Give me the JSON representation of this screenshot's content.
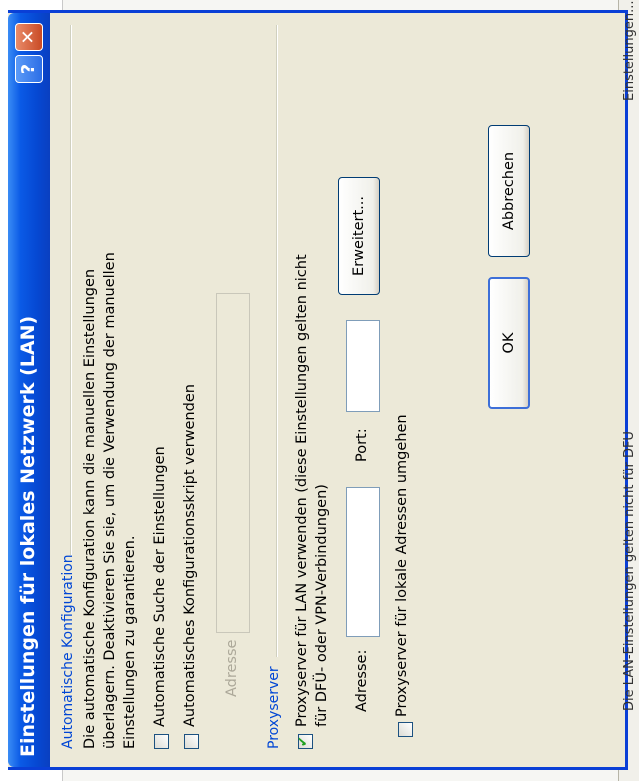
{
  "dialog": {
    "title": "Einstellungen für lokales Netzwerk (LAN)",
    "help_label": "?",
    "close_label": "✕",
    "auto_config": {
      "group_title": "Automatische Konfiguration",
      "description_lines": [
        "Die automatische Konfiguration kann die manuellen Einstellungen",
        "überlagern. Deaktivieren Sie sie, um die Verwendung der manuellen",
        "Einstellungen zu garantieren."
      ],
      "auto_detect": {
        "label": "Automatische Suche der Einstellungen",
        "checked": false
      },
      "use_script": {
        "label": "Automatisches Konfigurationsskript verwenden",
        "checked": false
      },
      "script_address_label": "Adresse",
      "script_address_value": ""
    },
    "proxy": {
      "group_title": "Proxyserver",
      "use_proxy": {
        "label_lines": [
          "Proxyserver für LAN verwenden (diese Einstellungen gelten nicht",
          "für DFÜ- oder VPN-Verbindungen)"
        ],
        "checked": true
      },
      "address_label": "Adresse:",
      "address_value": "",
      "port_label": "Port:",
      "port_value": "",
      "advanced_button": "Erweitert...",
      "bypass_local": {
        "label": "Proxyserver für lokale Adressen umgehen",
        "checked": false
      }
    },
    "ok_button": "OK",
    "cancel_button": "Abbrechen"
  },
  "background": {
    "partial_text": "Die LAN-Einstellungen gelten nicht für DFÜ",
    "partial_button": "Einstellungen..."
  },
  "colors": {
    "titlebar": "#0a5ae6",
    "group_title": "#0046d5",
    "dialog_bg": "#ece9d8"
  }
}
